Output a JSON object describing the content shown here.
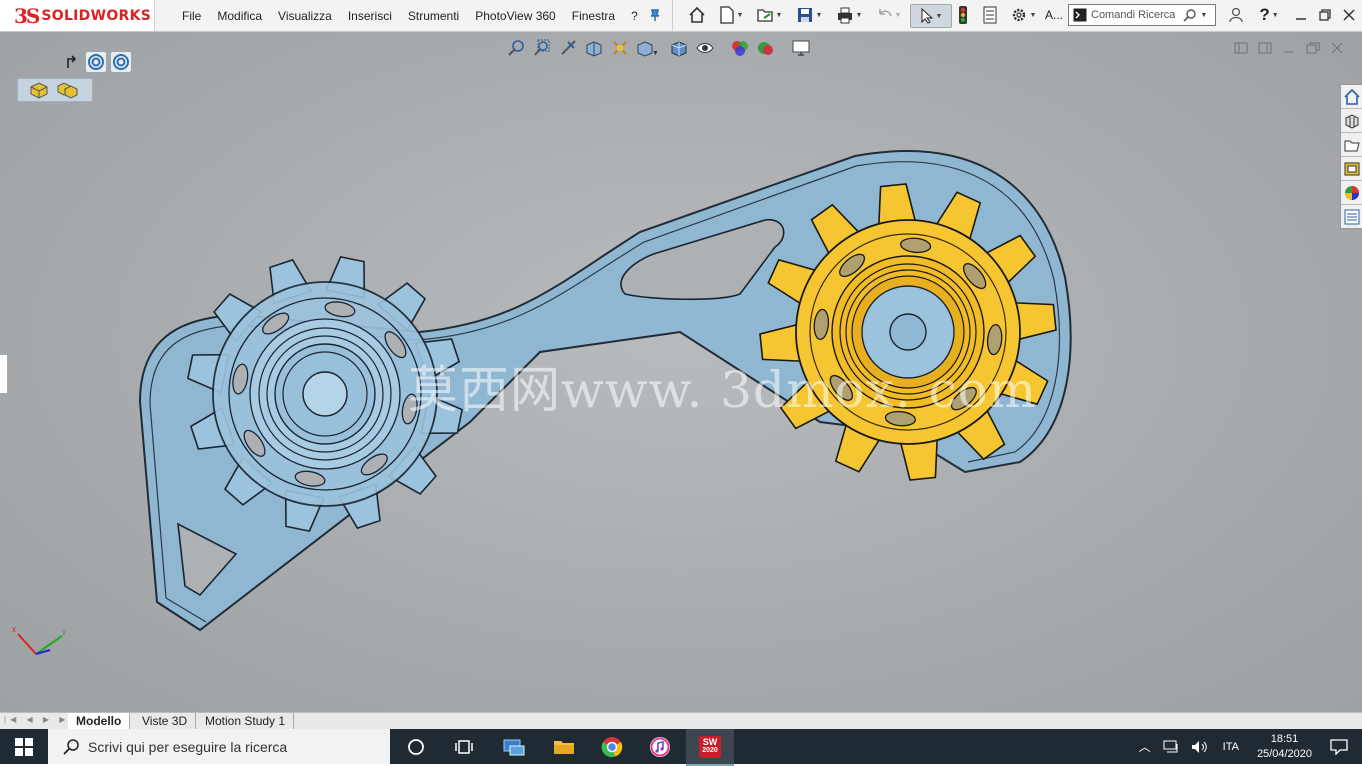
{
  "app": {
    "logo_ds": "3S",
    "logo_text": "SOLIDWORKS",
    "search_label": "Comandi Ricerca",
    "truncated_label": "A..."
  },
  "menu": [
    "File",
    "Modifica",
    "Visualizza",
    "Inserisci",
    "Strumenti",
    "PhotoView 360",
    "Finestra",
    "?"
  ],
  "watermark": "莫西网www. 3dmox. com",
  "tabs": [
    {
      "label": "Modello",
      "active": true
    },
    {
      "label": "Viste 3D",
      "active": false
    },
    {
      "label": "Motion Study 1",
      "active": false
    }
  ],
  "taskbar": {
    "search_placeholder": "Scrivi qui per eseguire la ricerca",
    "sw_badge": "2020",
    "lang": "ITA",
    "time": "18:51",
    "date": "25/04/2020"
  },
  "colors": {
    "link_blue": "#8fb8d4",
    "gear_gold": "#f4c230",
    "menubar": "#f3f3f3",
    "taskbar": "#1f2a33",
    "brand_red": "#d22222"
  }
}
